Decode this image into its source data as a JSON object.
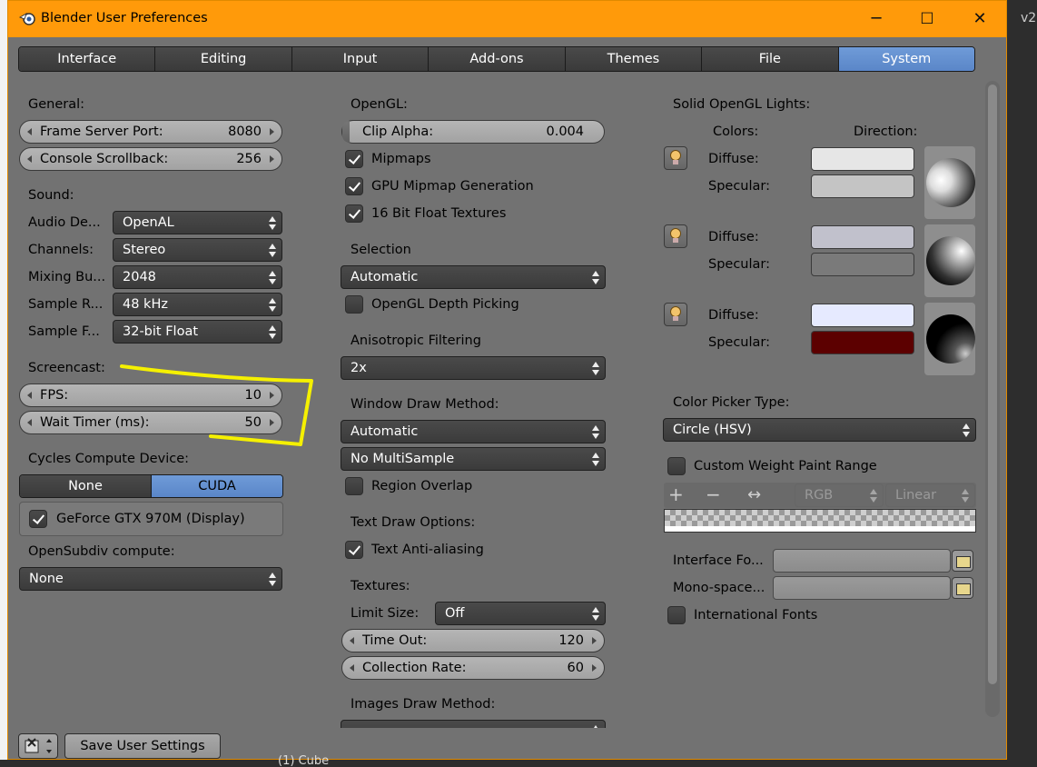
{
  "window": {
    "title": "Blender User Preferences",
    "minimize": "─",
    "maximize": "☐",
    "close": "✕"
  },
  "background": {
    "version_text": "v2",
    "status_text": "(1) Cube"
  },
  "tabs": [
    "Interface",
    "Editing",
    "Input",
    "Add-ons",
    "Themes",
    "File",
    "System"
  ],
  "active_tab": "System",
  "general": {
    "heading": "General:",
    "frame_server_port": {
      "label": "Frame Server Port:",
      "value": "8080"
    },
    "console_scrollback": {
      "label": "Console Scrollback:",
      "value": "256"
    }
  },
  "sound": {
    "heading": "Sound:",
    "rows": [
      {
        "label": "Audio De...",
        "value": "OpenAL"
      },
      {
        "label": "Channels:",
        "value": "Stereo"
      },
      {
        "label": "Mixing Bu...",
        "value": "2048"
      },
      {
        "label": "Sample R...",
        "value": "48 kHz"
      },
      {
        "label": "Sample F...",
        "value": "32-bit Float"
      }
    ]
  },
  "screencast": {
    "heading": "Screencast:",
    "fps": {
      "label": "FPS:",
      "value": "10"
    },
    "wait_timer": {
      "label": "Wait Timer (ms):",
      "value": "50"
    }
  },
  "cycles": {
    "heading": "Cycles Compute Device:",
    "options": [
      "None",
      "CUDA"
    ],
    "selected": "CUDA",
    "device_label": "GeForce GTX 970M (Display)",
    "device_checked": true
  },
  "opensubdiv": {
    "heading": "OpenSubdiv compute:",
    "value": "None"
  },
  "opengl": {
    "heading": "OpenGL:",
    "clip_alpha": {
      "label": "Clip Alpha:",
      "value": "0.004"
    },
    "mipmaps": "Mipmaps",
    "gpu_mipmap": "GPU Mipmap Generation",
    "float_textures": "16 Bit Float Textures"
  },
  "selection": {
    "heading": "Selection",
    "value": "Automatic",
    "depth_picking": "OpenGL Depth Picking"
  },
  "anisotropic": {
    "heading": "Anisotropic Filtering",
    "value": "2x"
  },
  "window_draw": {
    "heading": "Window Draw Method:",
    "value": "Automatic",
    "multisample": "No MultiSample",
    "region_overlap": "Region Overlap"
  },
  "text_draw": {
    "heading": "Text Draw Options:",
    "anti_aliasing": "Text Anti-aliasing"
  },
  "textures": {
    "heading": "Textures:",
    "limit_size_label": "Limit Size:",
    "limit_size": "Off",
    "time_out": {
      "label": "Time Out:",
      "value": "120"
    },
    "collection_rate": {
      "label": "Collection Rate:",
      "value": "60"
    }
  },
  "images_draw": {
    "heading": "Images Draw Method:"
  },
  "lights": {
    "heading": "Solid OpenGL Lights:",
    "colors_label": "Colors:",
    "direction_label": "Direction:",
    "diffuse_label": "Diffuse:",
    "specular_label": "Specular:",
    "items": [
      {
        "icon": "light-bulb-icon",
        "diffuse": "#e6e6e6",
        "specular": "#c4c4c4"
      },
      {
        "icon": "light-bulb-icon",
        "diffuse": "#c1c1cc",
        "specular": "#7a7a7a"
      },
      {
        "icon": "light-bulb-icon",
        "diffuse": "#e6eaff",
        "specular": "#5c0000"
      }
    ]
  },
  "color_picker": {
    "heading": "Color Picker Type:",
    "value": "Circle (HSV)"
  },
  "weight_paint": {
    "label": "Custom Weight Paint Range",
    "add": "+",
    "remove": "−",
    "flip": "↔",
    "color_mode": "RGB",
    "interpolation": "Linear"
  },
  "fonts": {
    "interface_font": "Interface Fo...",
    "mono_font": "Mono-space...",
    "international": "International Fonts"
  },
  "footer": {
    "save_label": "Save User Settings",
    "editor_icon": "preferences-editor-icon"
  },
  "annotation": {
    "color": "#f5f000"
  },
  "colors": {
    "title_bar": "#ff9a0a",
    "panel": "#727272",
    "active_tab": "#5a86c8"
  }
}
